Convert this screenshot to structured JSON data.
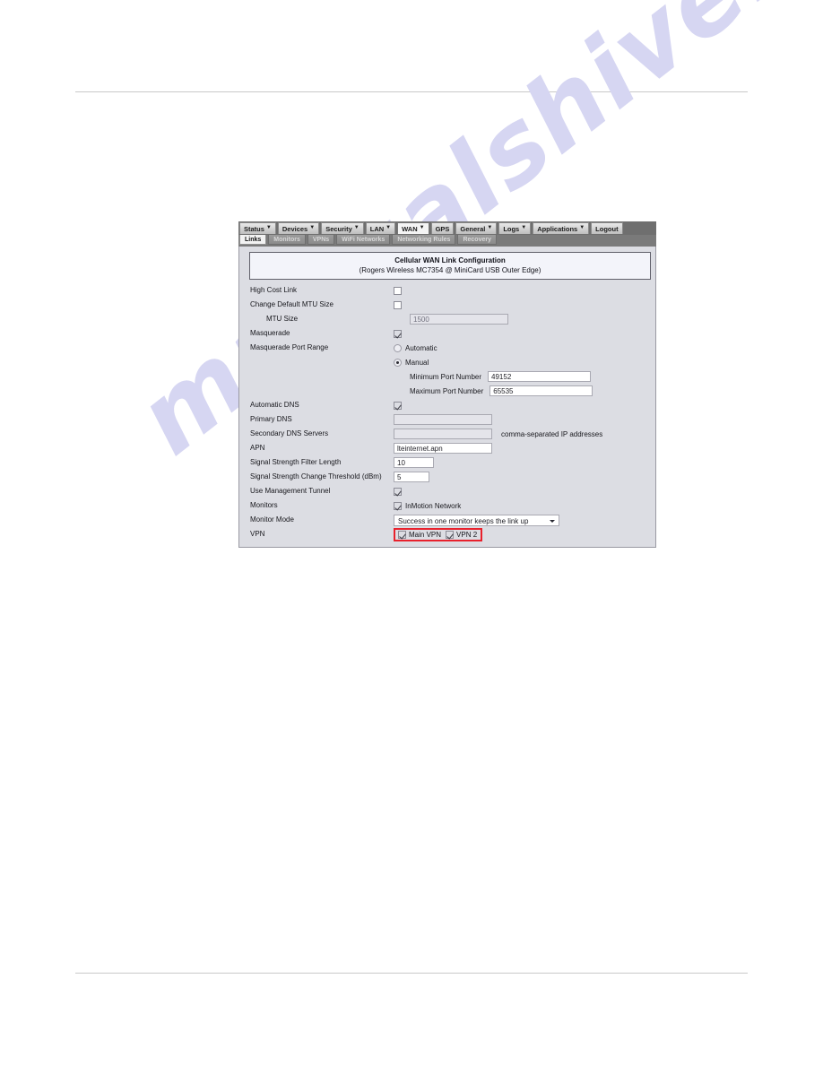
{
  "document": {
    "header_rule": true,
    "footer_rule": true
  },
  "watermark": {
    "text": "manualshive.com",
    "color": "#d6d6f2"
  },
  "screenshot": {
    "menubar": {
      "items": [
        {
          "label": "Status",
          "caret": "▼",
          "active": false
        },
        {
          "label": "Devices",
          "caret": "▼",
          "active": false
        },
        {
          "label": "Security",
          "caret": "▼",
          "active": false
        },
        {
          "label": "LAN",
          "caret": "▼",
          "active": false
        },
        {
          "label": "WAN",
          "caret": "▼",
          "active": true
        },
        {
          "label": "GPS",
          "caret": "",
          "active": false
        },
        {
          "label": "General",
          "caret": "▼",
          "active": false
        },
        {
          "label": "Logs",
          "caret": "▼",
          "active": false
        },
        {
          "label": "Applications",
          "caret": "▼",
          "active": false
        },
        {
          "label": "Logout",
          "caret": "",
          "active": false
        }
      ]
    },
    "subbar": {
      "items": [
        {
          "label": "Links",
          "active": true
        },
        {
          "label": "Monitors",
          "active": false
        },
        {
          "label": "VPNs",
          "active": false
        },
        {
          "label": "WiFi Networks",
          "active": false
        },
        {
          "label": "Networking Rules",
          "active": false
        },
        {
          "label": "Recovery",
          "active": false
        }
      ]
    },
    "panel": {
      "title_line1": "Cellular WAN Link Configuration",
      "title_line2": "(Rogers Wireless MC7354 @ MiniCard USB Outer Edge)"
    },
    "form": {
      "high_cost_link": {
        "label": "High Cost Link",
        "checked": false
      },
      "change_default_mtu": {
        "label": "Change Default MTU Size",
        "checked": false
      },
      "mtu_size": {
        "label": "MTU Size",
        "value": "1500",
        "disabled": true
      },
      "masquerade": {
        "label": "Masquerade",
        "checked": true
      },
      "masquerade_port_range": {
        "label": "Masquerade Port Range",
        "option_automatic": "Automatic",
        "option_manual": "Manual",
        "selected": "Manual",
        "min_port_label": "Minimum Port Number",
        "min_port_value": "49152",
        "max_port_label": "Maximum Port Number",
        "max_port_value": "65535"
      },
      "automatic_dns": {
        "label": "Automatic DNS",
        "checked": true
      },
      "primary_dns": {
        "label": "Primary DNS",
        "value": "",
        "disabled": true
      },
      "secondary_dns": {
        "label": "Secondary DNS Servers",
        "value": "",
        "disabled": true,
        "hint": "comma-separated IP addresses"
      },
      "apn": {
        "label": "APN",
        "value": "lteinternet.apn"
      },
      "signal_filter_length": {
        "label": "Signal Strength Filter Length",
        "value": "10"
      },
      "signal_change_threshold": {
        "label": "Signal Strength Change Threshold (dBm)",
        "value": "5"
      },
      "use_management_tunnel": {
        "label": "Use Management Tunnel",
        "checked": true
      },
      "monitors": {
        "label": "Monitors",
        "option_label": "InMotion Network",
        "checked": true
      },
      "monitor_mode": {
        "label": "Monitor Mode",
        "value": "Success in one monitor keeps the link up"
      },
      "vpn": {
        "label": "VPN",
        "highlighted": true,
        "options": [
          {
            "label": "Main VPN",
            "checked": true
          },
          {
            "label": "VPN 2",
            "checked": true
          }
        ]
      }
    }
  }
}
